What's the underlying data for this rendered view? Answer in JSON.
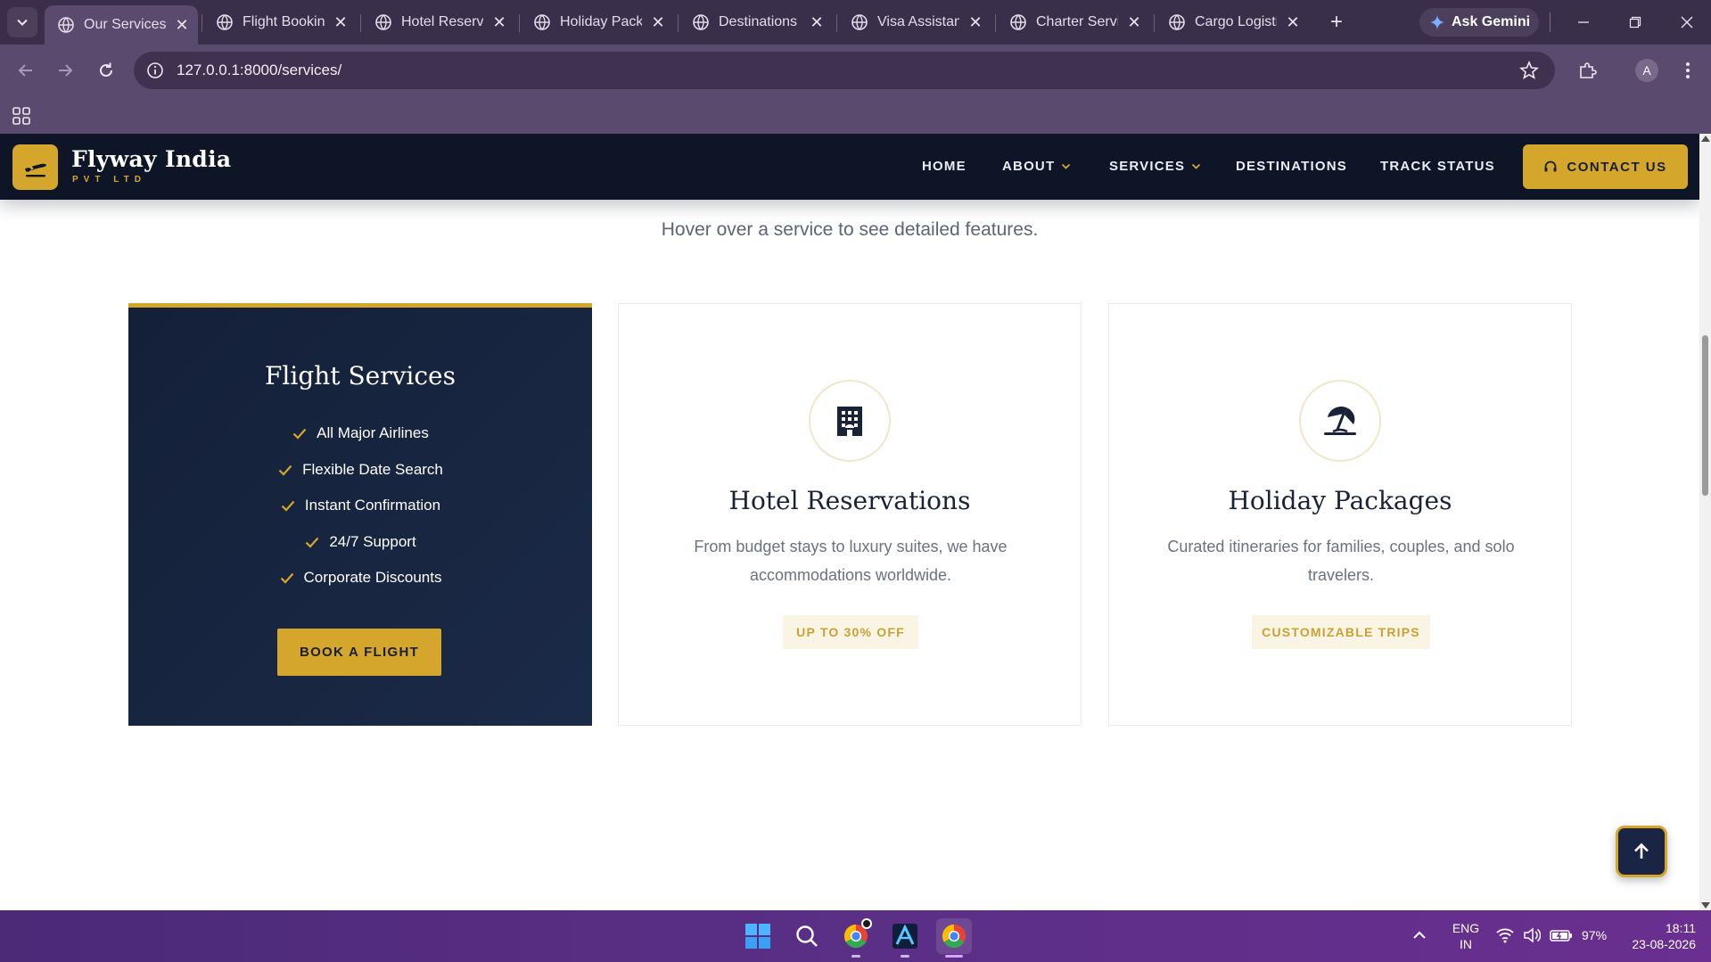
{
  "browser": {
    "tabs": [
      {
        "title": "Our Services |"
      },
      {
        "title": "Flight Booking"
      },
      {
        "title": "Hotel Reserva"
      },
      {
        "title": "Holiday Packa"
      },
      {
        "title": "Destinations |"
      },
      {
        "title": "Visa Assistanc"
      },
      {
        "title": "Charter Servic"
      },
      {
        "title": "Cargo Logistic"
      }
    ],
    "new_tab_label": "+",
    "gemini_label": "Ask Gemini",
    "url": "127.0.0.1:8000/services/",
    "profile_initial": "A"
  },
  "header": {
    "brand": "Flyway India",
    "brand_sub": "PVT LTD",
    "nav": {
      "home": "HOME",
      "about": "ABOUT",
      "services": "SERVICES",
      "destinations": "DESTINATIONS",
      "track": "TRACK STATUS"
    },
    "contact_label": "CONTACT US",
    "accent_color": "#d4a72c",
    "bg_color": "#0d1526"
  },
  "main": {
    "subtitle": "Hover over a service to see detailed features.",
    "cards": [
      {
        "title": "Flight Services",
        "features": [
          "All Major Airlines",
          "Flexible Date Search",
          "Instant Confirmation",
          "24/7 Support",
          "Corporate Discounts"
        ],
        "button_label": "BOOK A FLIGHT"
      },
      {
        "title": "Hotel Reservations",
        "icon": "building-icon",
        "description": "From budget stays to luxury suites, we have accommodations worldwide.",
        "tag": "UP TO 30% OFF"
      },
      {
        "title": "Holiday Packages",
        "icon": "umbrella-beach-icon",
        "description": "Curated itineraries for families, couples, and solo travelers.",
        "tag": "CUSTOMIZABLE TRIPS"
      }
    ]
  },
  "taskbar": {
    "lang_top": "ENG",
    "lang_bottom": "IN",
    "battery": "97%",
    "time": "18:11",
    "date": "23-08-2026"
  }
}
